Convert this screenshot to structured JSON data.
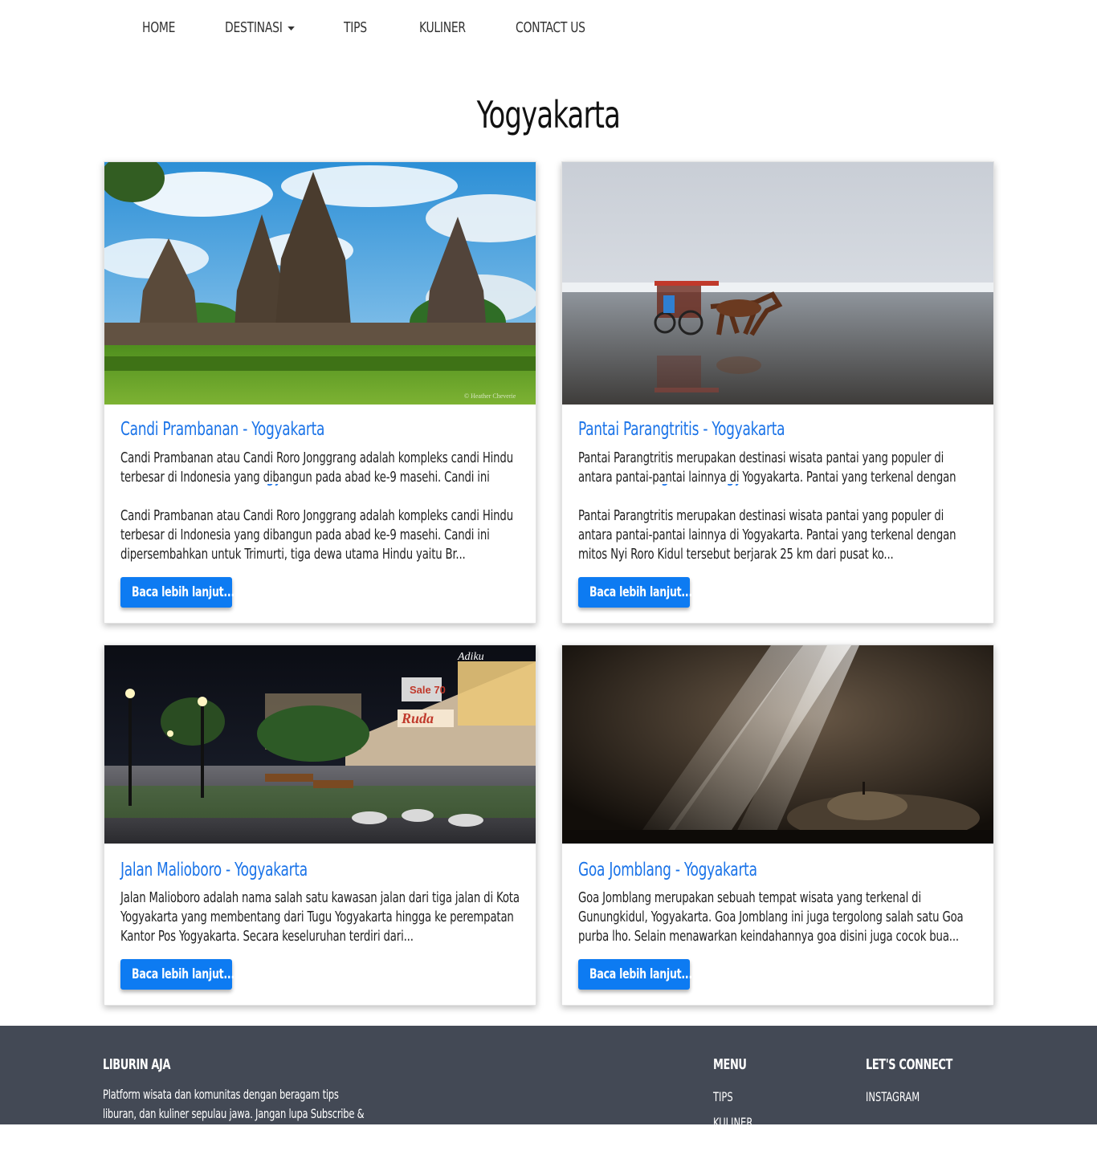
{
  "nav": {
    "home": "HOME",
    "destinasi": "DESTINASI",
    "tips": "TIPS",
    "kuliner": "KULINER",
    "contact": "CONTACT US"
  },
  "page": {
    "title": "Yogyakarta"
  },
  "cards": [
    {
      "title": "Candi Prambanan - Yogyakarta",
      "text_preview": "Candi Prambanan atau Candi Roro Jonggrang adalah kompleks candi Hindu terbesar di Indonesia yang dibangun pada abad ke-9 masehi. Candi ini",
      "text": "Candi Prambanan atau Candi Roro Jonggrang adalah kompleks candi Hindu terbesar di Indonesia yang dibangun pada abad ke-9 masehi. Candi ini dipersembahkan untuk Trimurti, tiga dewa utama Hindu yaitu Br...",
      "button": "Baca lebih lanjut...",
      "image_caption": "© Heather Cheverie"
    },
    {
      "title": "Pantai Parangtritis - Yogyakarta",
      "text_preview": "Pantai Parangtritis merupakan destinasi wisata pantai yang populer di antara pantai-pantai lainnya di Yogyakarta. Pantai yang terkenal dengan mitos Nyi Roro",
      "text": "Pantai Parangtritis merupakan destinasi wisata pantai yang populer di antara pantai-pantai lainnya di Yogyakarta. Pantai yang terkenal dengan mitos Nyi Roro Kidul tersebut berjarak 25 km dari pusat ko...",
      "button": "Baca lebih lanjut..."
    },
    {
      "title": "Jalan Malioboro - Yogyakarta",
      "text": "Jalan Malioboro adalah nama salah satu kawasan jalan dari tiga jalan di Kota Yogyakarta yang membentang dari Tugu Yogyakarta hingga ke perempatan Kantor Pos Yogyakarta. Secara keseluruhan terdiri dari...",
      "button": "Baca lebih lanjut...",
      "image_signs": [
        "Adiku",
        "Sale 70",
        "Ruda"
      ]
    },
    {
      "title": "Goa Jomblang - Yogyakarta",
      "text": "Goa Jomblang merupakan sebuah tempat wisata yang terkenal di Gunungkidul, Yogyakarta. Goa Jomblang ini juga tergolong salah satu Goa purba lho. Selain menawarkan keindahannya goa disini juga cocok bua...",
      "button": "Baca lebih lanjut..."
    }
  ],
  "footer": {
    "brand": "LIBURIN AJA",
    "description": "Platform wisata dan komunitas dengan beragam tips liburan, dan kuliner sepulau jawa. Jangan lupa Subscribe & Like agar",
    "menu_title": "MENU",
    "menu_items": [
      "TIPS",
      "KULINER"
    ],
    "connect_title": "LET'S CONNECT",
    "connect_items": [
      "INSTAGRAM"
    ]
  },
  "colors": {
    "accent": "#1a73e8",
    "button": "#0d7bf2",
    "footer_bg": "#434955"
  }
}
